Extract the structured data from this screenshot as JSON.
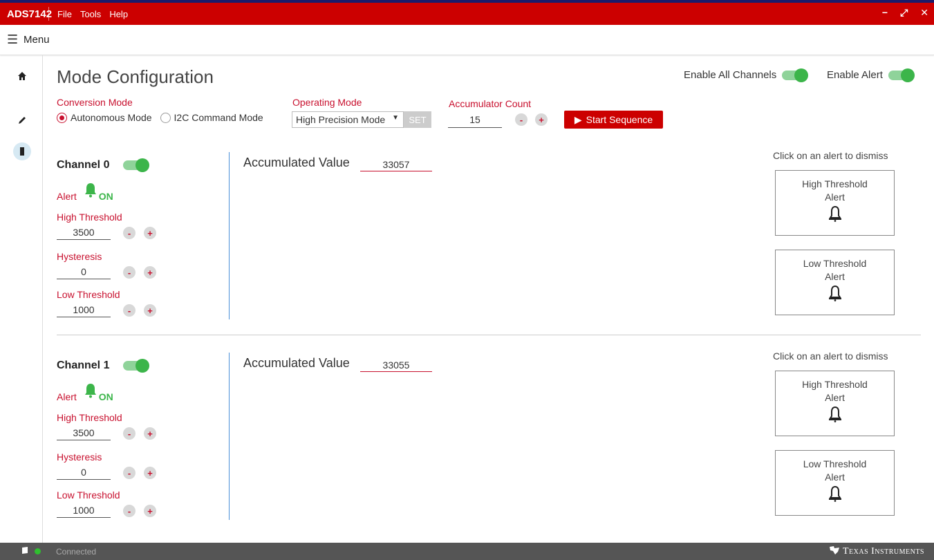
{
  "app": {
    "title": "ADS7142",
    "menus": [
      "File",
      "Tools",
      "Help"
    ],
    "window_controls": [
      "−",
      "⤢",
      "✕"
    ]
  },
  "menubar": {
    "label": "Menu"
  },
  "page": {
    "title": "Mode Configuration",
    "enable_all_channels": "Enable All Channels",
    "enable_alert": "Enable Alert",
    "conversion_mode_label": "Conversion Mode",
    "autonomous_mode": "Autonomous Mode",
    "i2c_command_mode": "I2C Command Mode",
    "operating_mode_label": "Operating Mode",
    "operating_mode_value": "High Precision Mode",
    "set_label": "SET",
    "accumulator_count_label": "Accumulator Count",
    "accumulator_count_value": "15",
    "start_sequence": "Start Sequence"
  },
  "channels": [
    {
      "title": "Channel 0",
      "alert_label": "Alert",
      "alert_state": "ON",
      "high_threshold_label": "High Threshold",
      "high_threshold": "3500",
      "hysteresis_label": "Hysteresis",
      "hysteresis": "0",
      "low_threshold_label": "Low Threshold",
      "low_threshold": "1000",
      "accumulated_label": "Accumulated Value",
      "accumulated_value": "33057",
      "dismiss_text": "Click on an alert to dismiss",
      "high_alert_line1": "High Threshold",
      "high_alert_line2": "Alert",
      "low_alert_line1": "Low Threshold",
      "low_alert_line2": "Alert"
    },
    {
      "title": "Channel 1",
      "alert_label": "Alert",
      "alert_state": "ON",
      "high_threshold_label": "High Threshold",
      "high_threshold": "3500",
      "hysteresis_label": "Hysteresis",
      "hysteresis": "0",
      "low_threshold_label": "Low Threshold",
      "low_threshold": "1000",
      "accumulated_label": "Accumulated Value",
      "accumulated_value": "33055",
      "dismiss_text": "Click on an alert to dismiss",
      "high_alert_line1": "High Threshold",
      "high_alert_line2": "Alert",
      "low_alert_line1": "Low Threshold",
      "low_alert_line2": "Alert"
    }
  ],
  "status": {
    "connection": "Connected",
    "brand": "Texas Instruments"
  },
  "colors": {
    "brand_red": "#cc0000",
    "label_red": "#c8102e",
    "toggle_green": "#3cb54a",
    "divider_blue": "#4a90d9"
  }
}
